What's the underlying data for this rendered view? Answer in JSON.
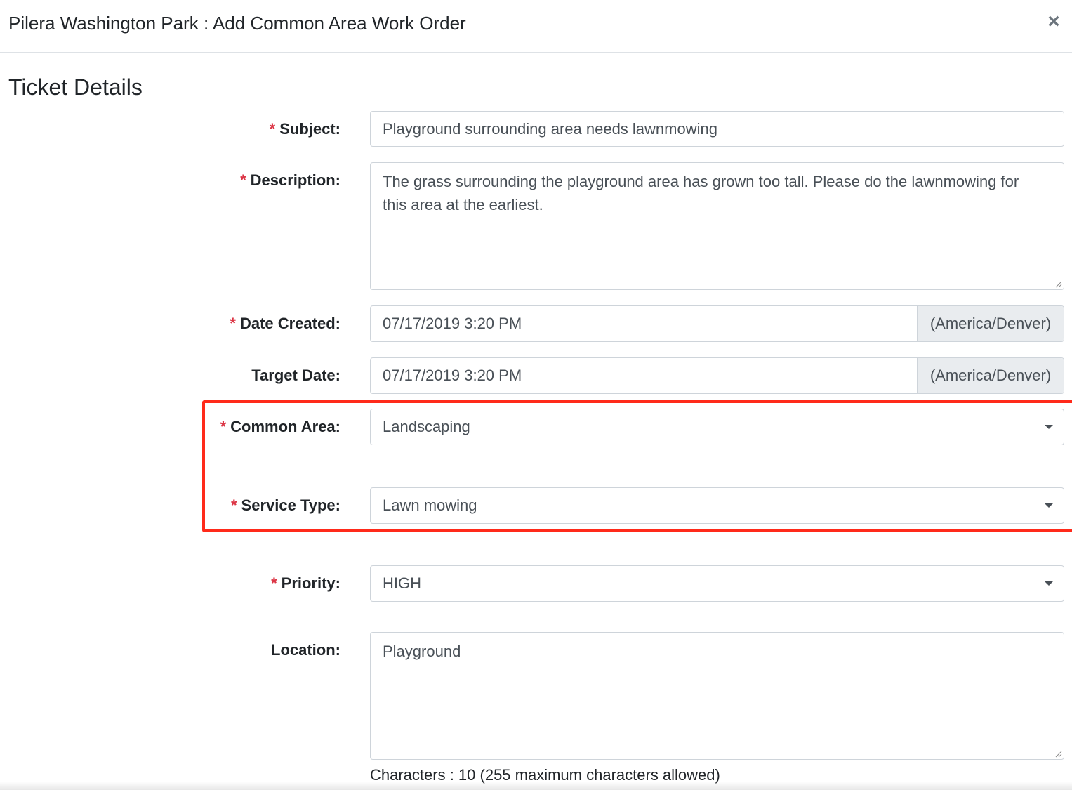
{
  "modal": {
    "title": "Pilera Washington Park : Add Common Area Work Order",
    "close_label": "×"
  },
  "section": {
    "title": "Ticket Details"
  },
  "required_marker": "*",
  "fields": {
    "subject": {
      "label": "Subject:",
      "required": true,
      "value": "Playground surrounding area needs lawnmowing"
    },
    "description": {
      "label": "Description:",
      "required": true,
      "value": "The grass surrounding the playground area has grown too tall.  Please do the lawnmowing for this area at the earliest."
    },
    "date_created": {
      "label": "Date Created:",
      "required": true,
      "value": "07/17/2019 3:20 PM",
      "timezone": "(America/Denver)"
    },
    "target_date": {
      "label": "Target Date:",
      "required": false,
      "value": "07/17/2019 3:20 PM",
      "timezone": "(America/Denver)"
    },
    "common_area": {
      "label": "Common Area:",
      "required": true,
      "value": "Landscaping"
    },
    "service_type": {
      "label": "Service Type:",
      "required": true,
      "value": "Lawn mowing"
    },
    "priority": {
      "label": "Priority:",
      "required": true,
      "value": "HIGH"
    },
    "location": {
      "label": "Location:",
      "required": false,
      "value": "Playground"
    }
  },
  "location_char_count": "Characters : 10 (255 maximum characters allowed)",
  "colors": {
    "required_asterisk": "#dc3545",
    "highlight_border": "#ff2a1a",
    "addon_background": "#e9ecef"
  }
}
